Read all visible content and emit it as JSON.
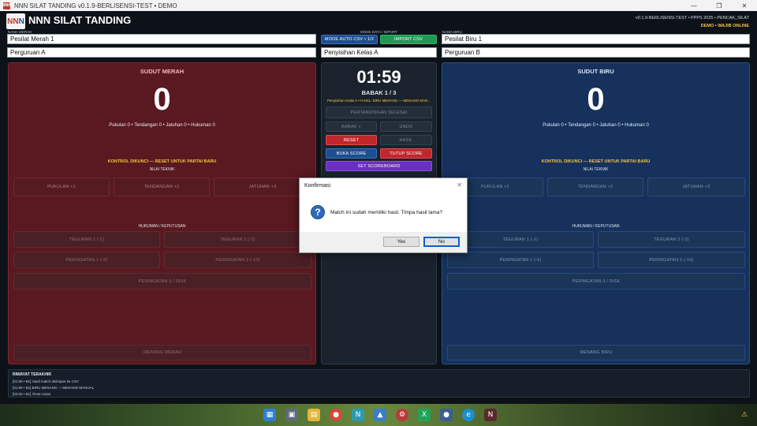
{
  "window": {
    "title": "NNN SILAT TANDING v0.1.9-BERLISENSI-TEST • DEMO",
    "app_icon_text": "NNN"
  },
  "header": {
    "logo_red": "NN",
    "logo_blue": "N",
    "app_title": "NNN SILAT TANDING",
    "version_line": "v0.1.9-BERLISENSI-TEST • PPPS 2025 • PENCAK_SILAT",
    "status_line": "DEMO • WAJIB ONLINE"
  },
  "red": {
    "name_label": "NAMA MERAH",
    "name": "Pesilat Merah 1",
    "school": "Perguruan A",
    "corner_title": "SUDUT MERAH",
    "score": "0",
    "score_line": "Pukulan 0  •  Tendangan 0  •  Jatuhan 0  •  Hukuman 0",
    "locked": "KONTROL DIKUNCI — RESET UNTUK PARTAI BARU",
    "teknik_label": "NILAI TEKNIK",
    "btn_pukulan": "PUKULAN +1",
    "btn_tendangan": "TENDANGAN +2",
    "btn_jatuhan": "JATUHAN +3",
    "hukuman_label": "HUKUMAN / KEPUTUSAN",
    "btn_teguran1": "TEGURAN 1  (-1)",
    "btn_teguran2": "TEGURAN 2  (-2)",
    "btn_peringatan1": "PERINGATAN 1  (-5)",
    "btn_peringatan2": "PERINGATAN 2  (-10)",
    "btn_peringatan3": "PERINGATAN 3 / DISK",
    "btn_menang": "MENANG MERAH"
  },
  "blue": {
    "name_label": "NAMA BIRU",
    "name": "Pesilat Biru 1",
    "school": "Perguruan B",
    "corner_title": "SUDUT BIRU",
    "score": "0",
    "score_line": "Pukulan 0  •  Tendangan 0  •  Jatuhan 0  •  Hukuman 0",
    "locked": "KONTROL DIKUNCI — RESET UNTUK PARTAI BARU",
    "teknik_label": "NILAI TEKNIK",
    "btn_pukulan": "PUKULAN +1",
    "btn_tendangan": "TENDANGAN +2",
    "btn_jatuhan": "JATUHAN +3",
    "hukuman_label": "HUKUMAN / KEPUTUSAN",
    "btn_teguran1": "TEGURAN 1  (-1)",
    "btn_teguran2": "TEGURAN 2  (-2)",
    "btn_peringatan1": "PERINGATAN 1  (-5)",
    "btn_peringatan2": "PERINGATAN 2  (-10)",
    "btn_peringatan3": "PERINGATAN 3 / DISK",
    "btn_menang": "MENANG BIRU"
  },
  "center": {
    "mode_label": "MODE DATA / IMPORT",
    "mode_button": "MODE AUTO CSV  •  1/2",
    "import_button": "IMPORT CSV",
    "kelas": "Penyisihan Kelas A",
    "timer": "01:59",
    "babak": "BABAK 1 / 3",
    "info": "Penyisihan Kelas A  •  HASIL: BIRU MENANG — MENANG MAN...",
    "btn_selesai": "PERTANDINGAN SELESAI",
    "btn_babak": "BABAK +",
    "btn_undo": "UNDO",
    "btn_reset": "RESET",
    "btn_hasil": "HASIL",
    "btn_buka": "BUKA SCORE",
    "btn_tutup": "TUTUP SCORE",
    "btn_scoreboard": "SET SCOREBOARD"
  },
  "history": {
    "title": "RIWAYAT TERAKHIR",
    "lines": [
      "[01:59 • B1] Hasil match disimpan ke CSV",
      "[01:59 • B1] BIRU MENANG — MENANG MANUAL",
      "[02:00 • B1] Timer mulai"
    ]
  },
  "dialog": {
    "title": "Konfirmasi",
    "message": "Match ini sudah memiliki hasil. Timpa hasil lama?",
    "yes": "Yes",
    "no": "No"
  },
  "colors": {
    "red_panel": "#5a1820",
    "blue_panel": "#15315c",
    "reset": "#c0272d",
    "buka": "#1d4f91",
    "tutup": "#c0272d",
    "scoreboard": "#6a2fc4",
    "import": "#1f9a55"
  }
}
